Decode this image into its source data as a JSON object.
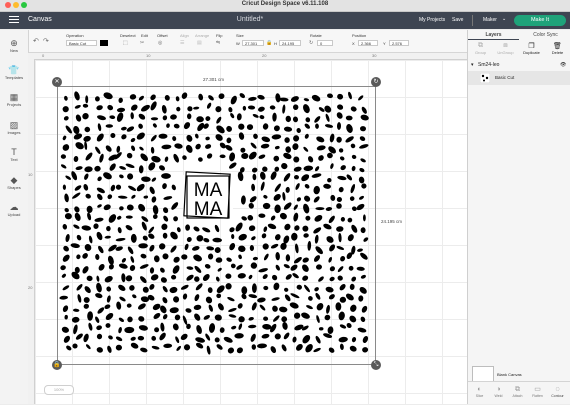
{
  "app": {
    "window_title": "Cricut Design Space  v6.11.108"
  },
  "header": {
    "canvas_label": "Canvas",
    "document_title": "Untitled*",
    "my_projects": "My Projects",
    "save": "Save",
    "machine": "Maker",
    "make_it": "Make It"
  },
  "edit_toolbar": {
    "undo_icon": "undo-icon",
    "redo_icon": "redo-icon",
    "operation_label": "Operation",
    "operation_value": "Basic Cut",
    "deselect_label": "Deselect",
    "edit_label": "Edit",
    "offset_label": "Offset",
    "align_label": "Align",
    "arrange_label": "Arrange",
    "flip_label": "Flip",
    "size_label": "Size",
    "size_w_prefix": "W",
    "size_w": "27.301",
    "size_h_prefix": "H",
    "size_h": "24.195",
    "rotate_label": "Rotate",
    "rotate_value": "0",
    "position_label": "Position",
    "pos_x_prefix": "X",
    "pos_x": "2.366",
    "pos_y_prefix": "Y",
    "pos_y": "2.576"
  },
  "left_sidebar": {
    "items": [
      {
        "label": "New",
        "icon": "plus-icon"
      },
      {
        "label": "Templates",
        "icon": "shirt-icon"
      },
      {
        "label": "Projects",
        "icon": "projects-icon"
      },
      {
        "label": "Images",
        "icon": "image-icon"
      },
      {
        "label": "Text",
        "icon": "text-icon"
      },
      {
        "label": "Shapes",
        "icon": "shapes-icon"
      },
      {
        "label": "Upload",
        "icon": "upload-icon"
      }
    ]
  },
  "ruler": {
    "h_marks": [
      "0",
      "10",
      "20",
      "30"
    ],
    "v_marks": [
      "10",
      "20"
    ]
  },
  "canvas": {
    "width_label": "27.301 cm",
    "height_label": "24.195 cm",
    "zoom": "100%",
    "design_text_top": "MA",
    "design_text_bottom": "MA"
  },
  "right_panel": {
    "tabs": [
      "Layers",
      "Color Sync"
    ],
    "tools": [
      "Group",
      "UnGroup",
      "Duplicate",
      "Delete"
    ],
    "layer_group": "Sm24-leo",
    "layer_item": "Basic Cut",
    "blank_canvas": "Blank Canvas",
    "bottom_tools": [
      "Slice",
      "Weld",
      "Attach",
      "Flatten",
      "Contour"
    ]
  },
  "colors": {
    "header_bg": "#3e4552",
    "make_it": "#1fa37a",
    "accent": "#3e4552"
  }
}
